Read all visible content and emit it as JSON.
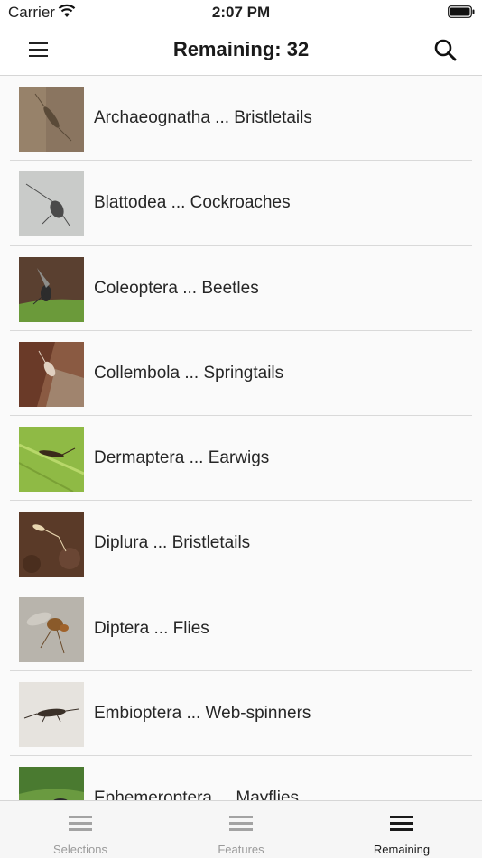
{
  "status_bar": {
    "carrier": "Carrier",
    "time": "2:07 PM"
  },
  "nav": {
    "title": "Remaining: 32",
    "menu_icon": "hamburger-icon",
    "search_icon": "search-icon"
  },
  "list": {
    "items": [
      {
        "label": "Archaeognatha ... Bristletails",
        "thumb_bg": "#8a7560",
        "thumb_fg": "#5a4a38"
      },
      {
        "label": "Blattodea ... Cockroaches",
        "thumb_bg": "#c9cbc9",
        "thumb_fg": "#4a4a4a"
      },
      {
        "label": "Coleoptera ... Beetles",
        "thumb_bg": "#6b9a3a",
        "thumb_fg": "#2c2c2c"
      },
      {
        "label": "Collembola ... Springtails",
        "thumb_bg": "#8a5a42",
        "thumb_fg": "#e0d0c0"
      },
      {
        "label": "Dermaptera ... Earwigs",
        "thumb_bg": "#8fba45",
        "thumb_fg": "#3a2a1a"
      },
      {
        "label": "Diplura ... Bristletails",
        "thumb_bg": "#5a3a28",
        "thumb_fg": "#e8d6b0"
      },
      {
        "label": "Diptera ... Flies",
        "thumb_bg": "#b8b4ac",
        "thumb_fg": "#8a5a2a"
      },
      {
        "label": "Embioptera ... Web-spinners",
        "thumb_bg": "#e6e3de",
        "thumb_fg": "#3a3028"
      },
      {
        "label": "Ephemeroptera ... Mayflies",
        "thumb_bg": "#4a7a30",
        "thumb_fg": "#2a2a2a"
      }
    ]
  },
  "tabs": [
    {
      "label": "Selections",
      "icon": "list-icon",
      "active": false
    },
    {
      "label": "Features",
      "icon": "list-icon",
      "active": false
    },
    {
      "label": "Remaining",
      "icon": "list-icon",
      "active": true
    }
  ]
}
